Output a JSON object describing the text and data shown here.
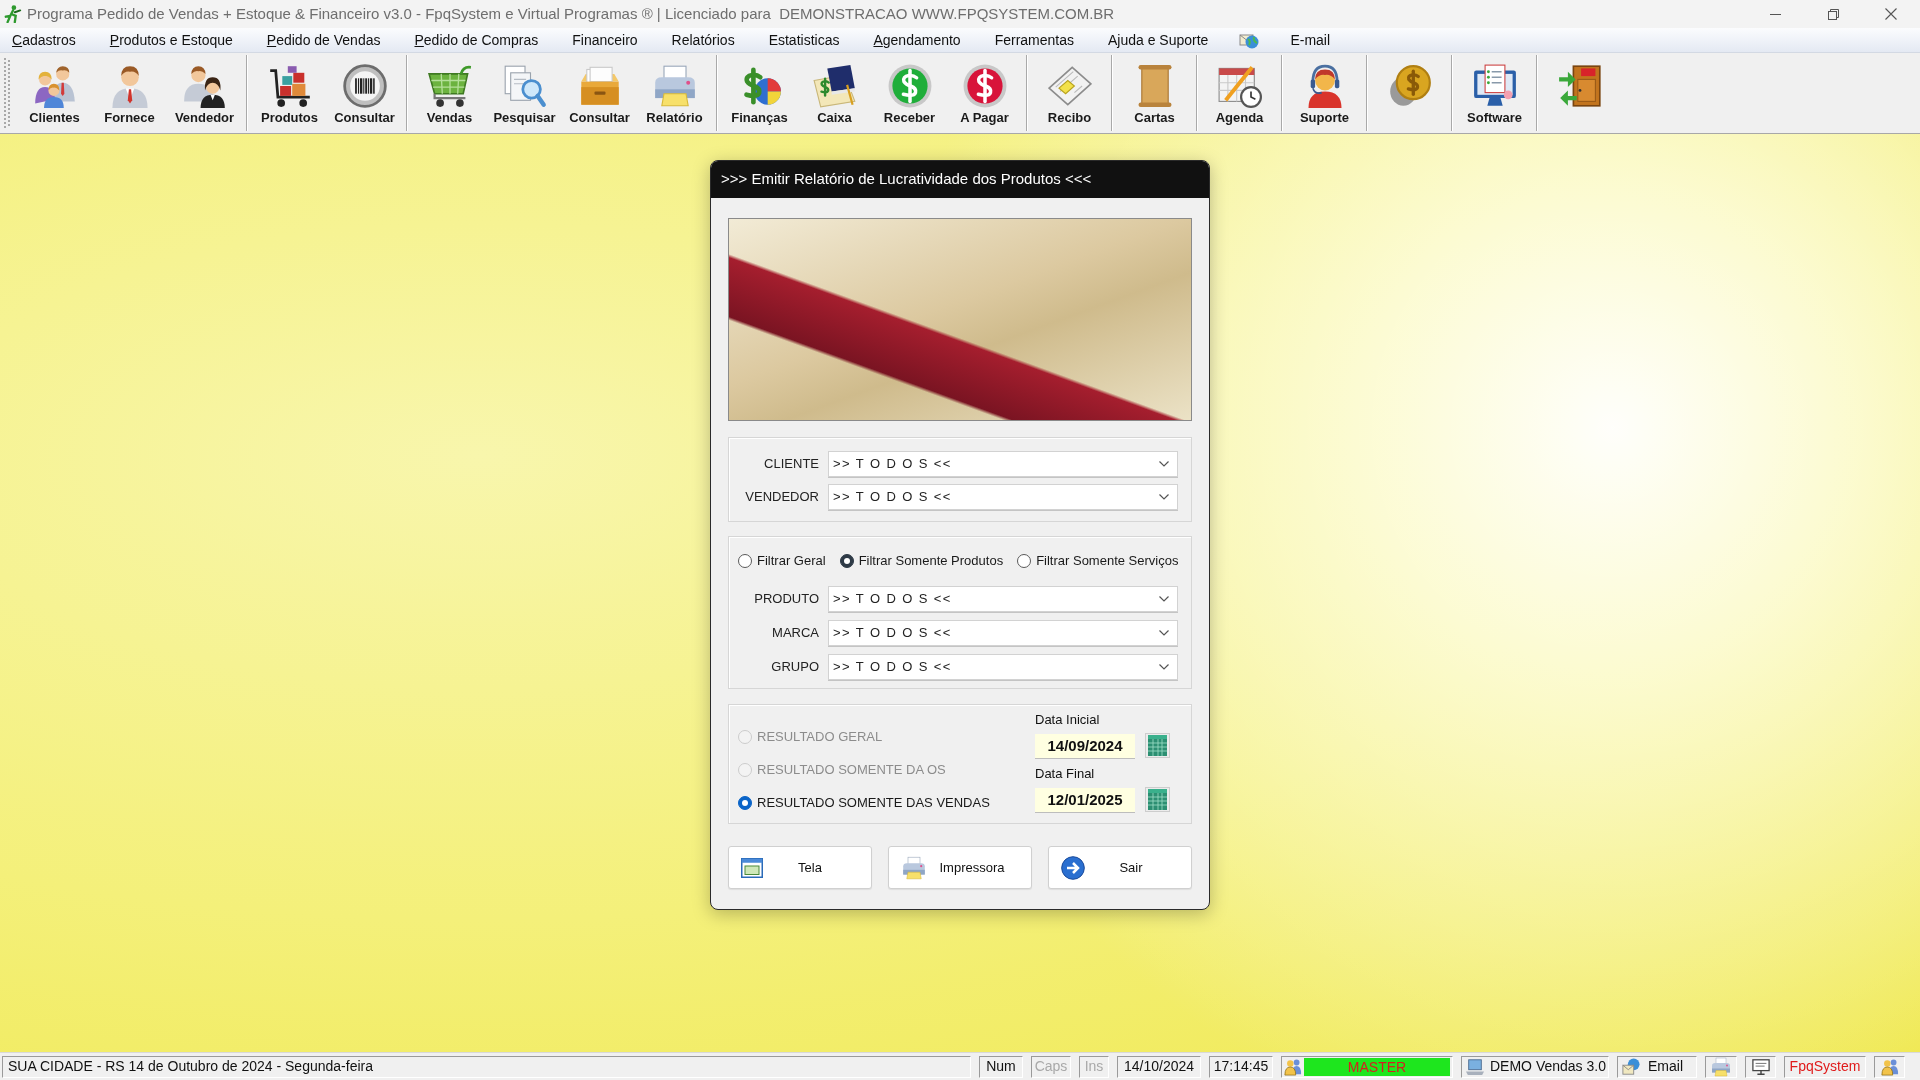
{
  "window": {
    "title": "Programa Pedido de Vendas + Estoque & Financeiro v3.0 - FpqSystem e Virtual Programas ® | Licenciado para  DEMONSTRACAO WWW.FPQSYSTEM.COM.BR"
  },
  "menu": [
    {
      "kind": "text",
      "label": "Cadastros",
      "mnemonic": true
    },
    {
      "kind": "text",
      "label": "Produtos e Estoque",
      "mnemonic": true
    },
    {
      "kind": "text",
      "label": "Pedido de Vendas",
      "mnemonic": true
    },
    {
      "kind": "text",
      "label": "Pedido de Compras",
      "mnemonic": true
    },
    {
      "kind": "text",
      "label": "Financeiro",
      "mnemonic": false
    },
    {
      "kind": "text",
      "label": "Relatórios",
      "mnemonic": false
    },
    {
      "kind": "text",
      "label": "Estatisticas",
      "mnemonic": false
    },
    {
      "kind": "text",
      "label": "Agendamento",
      "mnemonic": true
    },
    {
      "kind": "text",
      "label": "Ferramentas",
      "mnemonic": false
    },
    {
      "kind": "text",
      "label": "Ajuda e Suporte",
      "mnemonic": false
    },
    {
      "kind": "icon"
    },
    {
      "kind": "text",
      "label": "E-mail",
      "mnemonic": false
    }
  ],
  "toolbar": {
    "groups": [
      {
        "items": [
          {
            "kind": "labeled",
            "label": "Clientes"
          },
          {
            "kind": "labeled",
            "label": "Fornece"
          },
          {
            "kind": "labeled",
            "label": "Vendedor"
          }
        ]
      },
      {
        "items": [
          {
            "kind": "labeled",
            "label": "Produtos"
          },
          {
            "kind": "labeled",
            "label": "Consultar"
          }
        ]
      },
      {
        "items": [
          {
            "kind": "labeled",
            "label": "Vendas"
          },
          {
            "kind": "labeled",
            "label": "Pesquisar"
          },
          {
            "kind": "labeled",
            "label": "Consultar"
          },
          {
            "kind": "labeled",
            "label": "Relatório"
          }
        ]
      },
      {
        "items": [
          {
            "kind": "labeled",
            "label": "Finanças"
          },
          {
            "kind": "labeled",
            "label": "Caixa"
          },
          {
            "kind": "labeled",
            "label": "Receber"
          },
          {
            "kind": "labeled",
            "label": "A Pagar"
          }
        ]
      },
      {
        "items": [
          {
            "kind": "labeled",
            "label": "Recibo"
          }
        ]
      },
      {
        "items": [
          {
            "kind": "labeled",
            "label": "Cartas"
          }
        ]
      },
      {
        "items": [
          {
            "kind": "labeled",
            "label": "Agenda"
          }
        ]
      },
      {
        "items": [
          {
            "kind": "labeled",
            "label": "Suporte"
          }
        ]
      },
      {
        "items": [
          {
            "kind": "icon_only"
          }
        ]
      },
      {
        "items": [
          {
            "kind": "labeled",
            "label": "Software"
          }
        ]
      },
      {
        "items": [
          {
            "kind": "icon_only"
          }
        ]
      }
    ]
  },
  "dialog": {
    "title": ">>> Emitir Relatório de Lucratividade dos Produtos <<<",
    "filters": [
      {
        "label": "CLIENTE",
        "value": ">> T O D O S <<"
      },
      {
        "label": "VENDEDOR",
        "value": ">> T O D O S <<"
      }
    ],
    "filter_type": [
      {
        "label": "Filtrar Geral",
        "selected": false
      },
      {
        "label": "Filtrar Somente Produtos",
        "selected": true
      },
      {
        "label": "Filtrar Somente Serviços",
        "selected": false
      }
    ],
    "product_filters": [
      {
        "label": "PRODUTO",
        "value": ">> T O D O S <<"
      },
      {
        "label": "MARCA",
        "value": ">> T O D O S <<"
      },
      {
        "label": "GRUPO",
        "value": ">> T O D O S <<"
      }
    ],
    "result_type": [
      {
        "label": "RESULTADO GERAL",
        "selected": false,
        "disabled": true
      },
      {
        "label": "RESULTADO SOMENTE DA OS",
        "selected": false,
        "disabled": true
      },
      {
        "label": "RESULTADO SOMENTE DAS VENDAS",
        "selected": true,
        "disabled": false
      }
    ],
    "dates": [
      {
        "label": "Data Inicial",
        "value": "14/09/2024"
      },
      {
        "label": "Data Final",
        "value": "12/01/2025"
      }
    ],
    "buttons": [
      "Tela",
      "Impressora",
      "Sair"
    ]
  },
  "status_bar": {
    "location": "SUA CIDADE - RS 14 de Outubro de 2024 - Segunda-feira",
    "keys": [
      {
        "label": "Num",
        "on": true
      },
      {
        "label": "Caps",
        "on": false
      },
      {
        "label": "Ins",
        "on": false
      }
    ],
    "date": "14/10/2024",
    "time": "17:14:45",
    "user": "MASTER",
    "version": "DEMO Vendas 3.0",
    "email": "Email",
    "brand": "FpqSystem"
  }
}
